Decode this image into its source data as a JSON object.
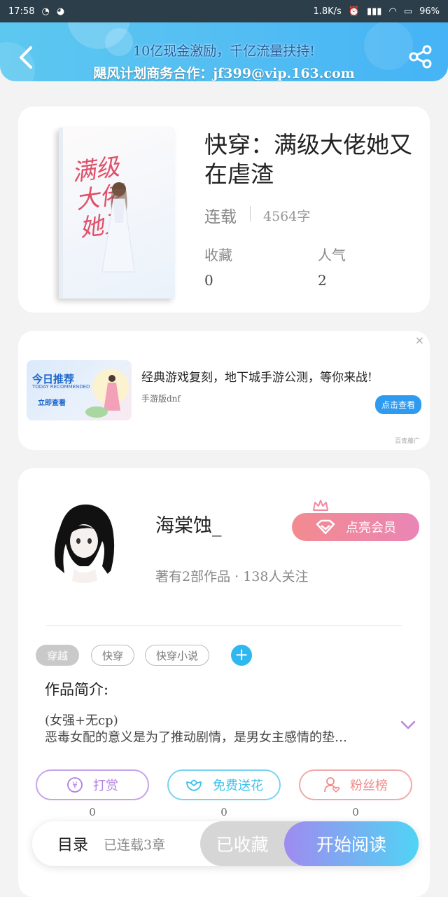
{
  "status_bar": {
    "time": "17:58",
    "network_speed": "1.8K/s",
    "battery": "96%"
  },
  "header": {
    "promo_line1": "10亿现金激励，千亿流量扶持!",
    "promo_line2": "飓风计划商务合作：jf399@vip.163.com",
    "back_icon": "chevron-left-icon",
    "share_icon": "share-icon"
  },
  "book": {
    "cover_text": "满级大佬她又",
    "title": "快穿：满级大佬她又在虐渣",
    "status": "连载",
    "word_count": "4564字",
    "stats": [
      {
        "label": "收藏",
        "value": "0"
      },
      {
        "label": "人气",
        "value": "2"
      }
    ]
  },
  "ad": {
    "thumb_title": "今日推荐",
    "thumb_subtitle": "TODAY RECOMMENDED",
    "thumb_button": "立即查看",
    "headline": "经典游戏复刻，地下城手游公测，等你来战!",
    "source": "手游版dnf",
    "cta": "点击查看",
    "mark": "百青藤广",
    "close": "×"
  },
  "author": {
    "name": "海棠蚀_",
    "meta": "著有2部作品 · 138人关注",
    "vip_button": "点亮会员"
  },
  "tags": [
    "穿越",
    "快穿",
    "快穿小说"
  ],
  "intro": {
    "title": "作品简介:",
    "line1": "(女强+无cp)",
    "line2": "恶毒女配的意义是为了推动剧情，是男女主感情的垫…"
  },
  "actions": [
    {
      "label": "打赏",
      "count": "0",
      "color": "#b07fe0"
    },
    {
      "label": "免费送花",
      "count": "0",
      "color": "#3cc0ea"
    },
    {
      "label": "粉丝榜",
      "count": "0",
      "color": "#ef8a8a"
    }
  ],
  "bottom_bar": {
    "toc_label": "目录",
    "toc_count": "已连载3章",
    "collect_label": "已收藏",
    "read_label": "开始阅读"
  }
}
